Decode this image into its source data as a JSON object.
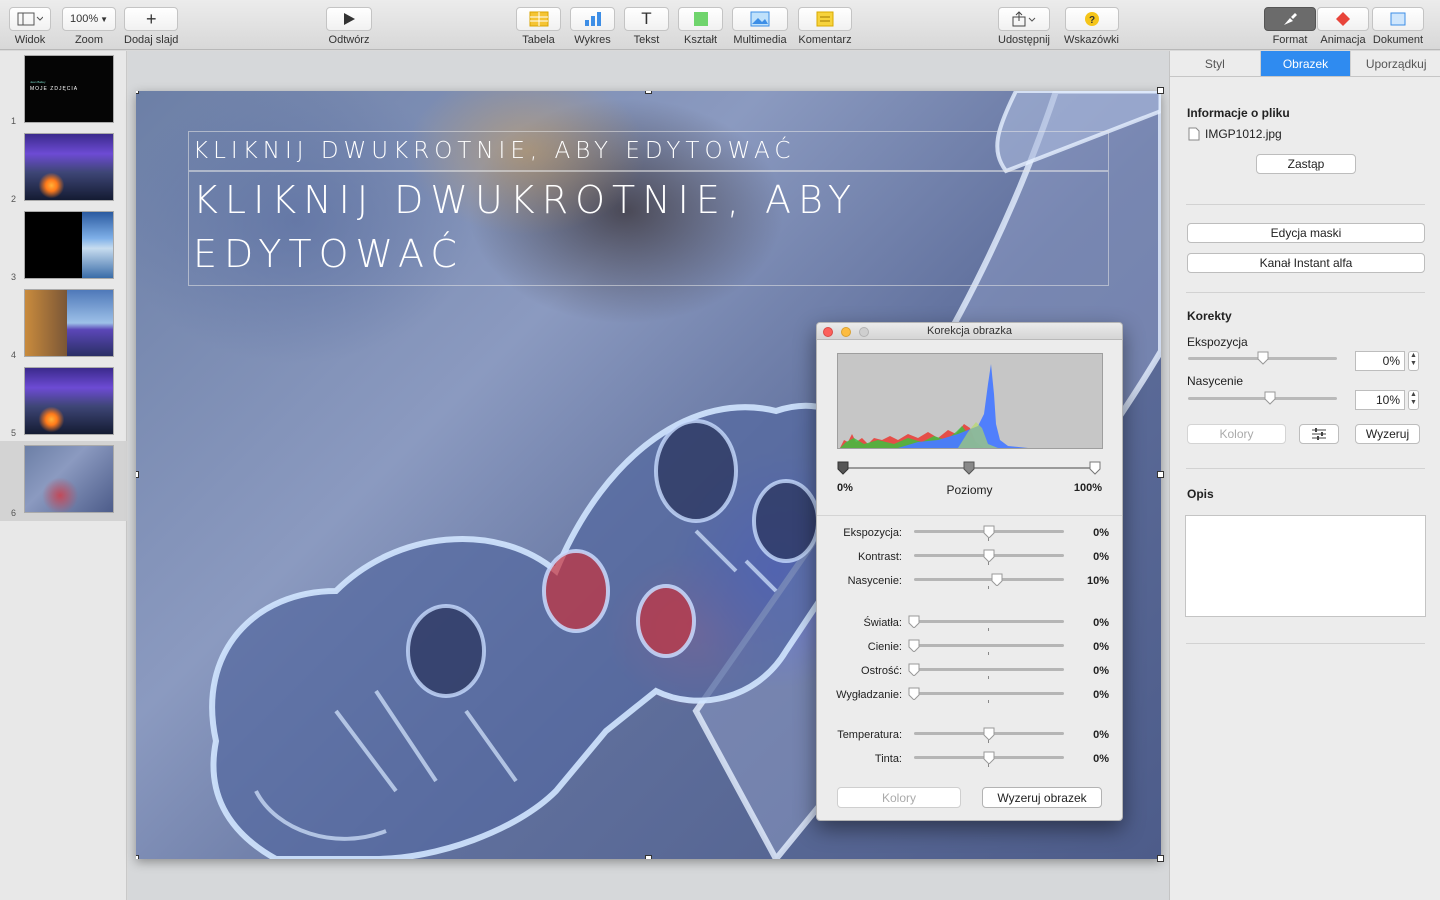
{
  "toolbar": {
    "view": {
      "label": "Widok"
    },
    "zoom": {
      "value": "100%",
      "label": "Zoom"
    },
    "add_slide": {
      "label": "Dodaj slajd"
    },
    "play": {
      "label": "Odtwórz"
    },
    "table": {
      "label": "Tabela"
    },
    "chart": {
      "label": "Wykres"
    },
    "text": {
      "label": "Tekst"
    },
    "shape": {
      "label": "Kształt"
    },
    "media": {
      "label": "Multimedia"
    },
    "comment": {
      "label": "Komentarz"
    },
    "share": {
      "label": "Udostępnij"
    },
    "tips": {
      "label": "Wskazówki"
    },
    "format": {
      "label": "Format"
    },
    "animate": {
      "label": "Animacja"
    },
    "document": {
      "label": "Dokument"
    }
  },
  "navigator": {
    "slides": [
      {
        "number": "1",
        "title": "MOJE ZDJĘCIA",
        "subtitle": "Jean Bailey"
      },
      {
        "number": "2"
      },
      {
        "number": "3"
      },
      {
        "number": "4"
      },
      {
        "number": "5"
      },
      {
        "number": "6",
        "selected": true
      }
    ]
  },
  "slide": {
    "subtitle": "KLIKNIJ DWUKROTNIE, ABY EDYTOWAĆ",
    "title_line1": "KLIKNIJ DWUKROTNIE, ABY",
    "title_line2": "EDYTOWAĆ"
  },
  "adjust_image": {
    "title": "Korekcja obrazka",
    "levels": {
      "left": "0%",
      "center": "Poziomy",
      "right": "100%"
    },
    "sliders": [
      {
        "label": "Ekspozycja:",
        "value": "0%",
        "fraction": 0.5
      },
      {
        "label": "Kontrast:",
        "value": "0%",
        "fraction": 0.5
      },
      {
        "label": "Nasycenie:",
        "value": "10%",
        "fraction": 0.55
      },
      {
        "label": "Światła:",
        "value": "0%",
        "fraction": 0
      },
      {
        "label": "Cienie:",
        "value": "0%",
        "fraction": 0
      },
      {
        "label": "Ostrość:",
        "value": "0%",
        "fraction": 0
      },
      {
        "label": "Wygładzanie:",
        "value": "0%",
        "fraction": 0
      },
      {
        "label": "Temperatura:",
        "value": "0%",
        "fraction": 0.5
      },
      {
        "label": "Tinta:",
        "value": "0%",
        "fraction": 0.5
      }
    ],
    "colors_button": "Kolory",
    "reset_button": "Wyzeruj obrazek"
  },
  "inspector": {
    "tabs": [
      {
        "label": "Styl",
        "active": false
      },
      {
        "label": "Obrazek",
        "active": true
      },
      {
        "label": "Uporządkuj",
        "active": false
      }
    ],
    "file_info": {
      "heading": "Informacje o pliku",
      "filename": "IMGP1012.jpg",
      "replace_button": "Zastąp"
    },
    "edit_mask_button": "Edycja maski",
    "instant_alpha_button": "Kanał Instant alfa",
    "adjustments": {
      "heading": "Korekty",
      "exposure": {
        "label": "Ekspozycja",
        "value": "0%",
        "fraction": 0.5
      },
      "saturation": {
        "label": "Nasycenie",
        "value": "10%",
        "fraction": 0.55
      },
      "colors_button": "Kolory",
      "reset_button": "Wyzeruj"
    },
    "description": {
      "heading": "Opis",
      "value": ""
    }
  },
  "colors": {
    "accent": "#2f8bf0",
    "close": "#fc605b",
    "minimize": "#fdbc40"
  }
}
